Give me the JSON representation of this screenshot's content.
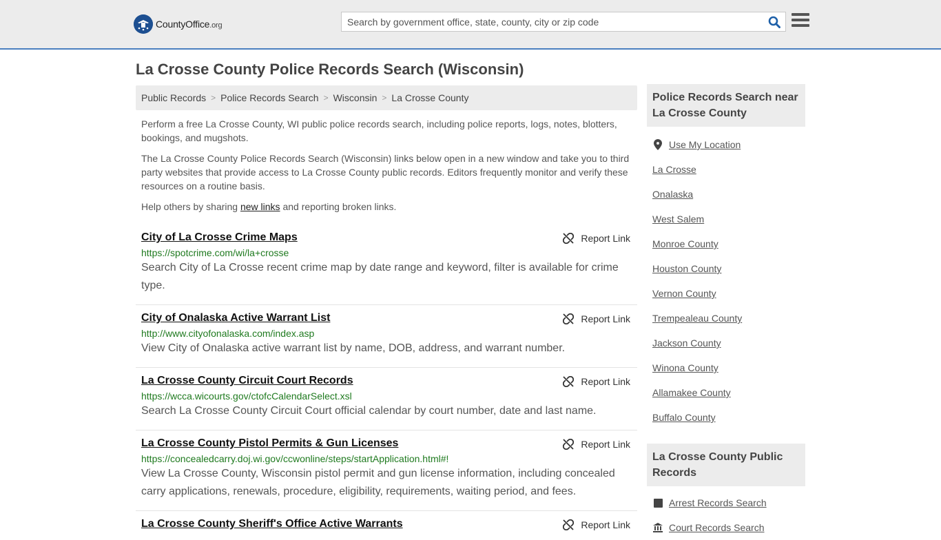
{
  "header": {
    "logo_text": "CountyOffice",
    "logo_suffix": ".org",
    "search_placeholder": "Search by government office, state, county, city or zip code"
  },
  "page_title": "La Crosse County Police Records Search (Wisconsin)",
  "breadcrumb": [
    "Public Records",
    "Police Records Search",
    "Wisconsin",
    "La Crosse County"
  ],
  "intro": {
    "p1": "Perform a free La Crosse County, WI public police records search, including police reports, logs, notes, blotters, bookings, and mugshots.",
    "p2": "The La Crosse County Police Records Search (Wisconsin) links below open in a new window and take you to third party websites that provide access to La Crosse County public records. Editors frequently monitor and verify these resources on a routine basis.",
    "p3_before": "Help others by sharing ",
    "p3_link": "new links",
    "p3_after": " and reporting broken links."
  },
  "report_label": "Report Link",
  "results": [
    {
      "title": "City of La Crosse Crime Maps",
      "url": "https://spotcrime.com/wi/la+crosse",
      "desc": "Search City of La Crosse recent crime map by date range and keyword, filter is available for crime type."
    },
    {
      "title": "City of Onalaska Active Warrant List",
      "url": "http://www.cityofonalaska.com/index.asp",
      "desc": "View City of Onalaska active warrant list by name, DOB, address, and warrant number."
    },
    {
      "title": "La Crosse County Circuit Court Records",
      "url": "https://wcca.wicourts.gov/ctofcCalendarSelect.xsl",
      "desc": "Search La Crosse County Circuit Court official calendar by court number, date and last name."
    },
    {
      "title": "La Crosse County Pistol Permits & Gun Licenses",
      "url": "https://concealedcarry.doj.wi.gov/ccwonline/steps/startApplication.html#!",
      "desc": "View La Crosse County, Wisconsin pistol permit and gun license information, including concealed carry applications, renewals, procedure, eligibility, requirements, waiting period, and fees."
    },
    {
      "title": "La Crosse County Sheriff's Office Active Warrants",
      "url": "",
      "desc": ""
    }
  ],
  "sidebar": {
    "near_heading": "Police Records Search near La Crosse County",
    "use_location": "Use My Location",
    "near_items": [
      "La Crosse",
      "Onalaska",
      "West Salem",
      "Monroe County",
      "Houston County",
      "Vernon County",
      "Trempealeau County",
      "Jackson County",
      "Winona County",
      "Allamakee County",
      "Buffalo County"
    ],
    "public_heading": "La Crosse County Public Records",
    "public_items": [
      "Arrest Records Search",
      "Court Records Search"
    ]
  },
  "colors": {
    "accent": "#4b7fbf",
    "url_green": "#1f7a1f",
    "header_bg": "#ececec",
    "seal_blue": "#1d4f91"
  }
}
